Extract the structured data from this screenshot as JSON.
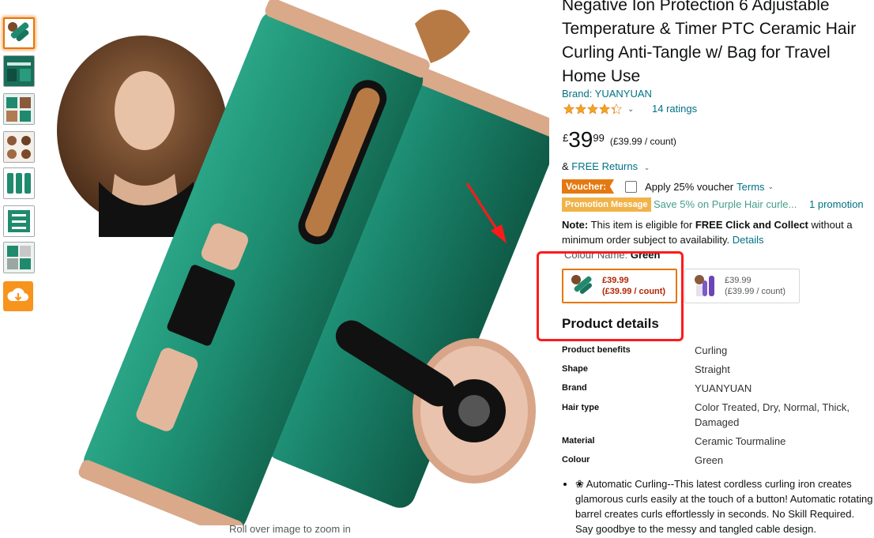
{
  "product": {
    "title": "Negative Ion Protection 6 Adjustable\nTemperature & Timer PTC Ceramic Hair\nCurling Anti-Tangle w/ Bag for Travel\nHome Use",
    "brand_label": "Brand: YUANYUAN",
    "rating_value": 4.3,
    "ratings_count": "14 ratings",
    "price_symbol": "£",
    "price_whole": "39",
    "price_fraction": "99",
    "price_per_unit": "(£39.99 / count)",
    "returns_prefix": "&",
    "returns_link": "FREE Returns",
    "voucher_tag": "Voucher:",
    "voucher_text": "Apply 25% voucher",
    "voucher_terms": "Terms",
    "promo_tag": "Promotion Message",
    "promo_text": "Save 5% on Purple Hair curle...",
    "promo_count": "1 promotion",
    "note_label": "Note:",
    "note_text_1": "This item is eligible for",
    "note_bold": "FREE Click and Collect",
    "note_text_2": "without a minimum order subject to availability.",
    "note_link": "Details",
    "colour_label": "Colour Name:",
    "colour_value": "Green",
    "swatches": [
      {
        "price": "£39.99",
        "unit": "(£39.99 / count)",
        "colour": "#1f8a6e"
      },
      {
        "price": "£39.99",
        "unit": "(£39.99 / count)",
        "colour": "#6b45b8"
      }
    ]
  },
  "gallery": {
    "zoom_hint": "Roll over image to zoom in",
    "accent": "#e77600"
  },
  "product_details": {
    "heading": "Product details",
    "rows": [
      {
        "key": "Product benefits",
        "value": "Curling"
      },
      {
        "key": "Shape",
        "value": "Straight"
      },
      {
        "key": "Brand",
        "value": "YUANYUAN"
      },
      {
        "key": "Hair type",
        "value": "Color Treated, Dry, Normal, Thick, Damaged"
      },
      {
        "key": "Material",
        "value": "Ceramic Tourmaline"
      },
      {
        "key": "Colour",
        "value": "Green"
      }
    ]
  },
  "bullets": [
    "❀ Automatic Curling--This latest cordless curling iron creates glamorous curls easily at the touch of a button! Automatic rotating barrel creates curls effortlessly in seconds. No Skill Required. Say goodbye to the messy and tangled cable design."
  ],
  "colors": {
    "link": "#007185",
    "price_red": "#b12704",
    "voucher_orange": "#e47911",
    "promo_gold": "#f0b34a",
    "annotation_red": "#ff1a1a",
    "product_green": "#1f8a6e"
  }
}
